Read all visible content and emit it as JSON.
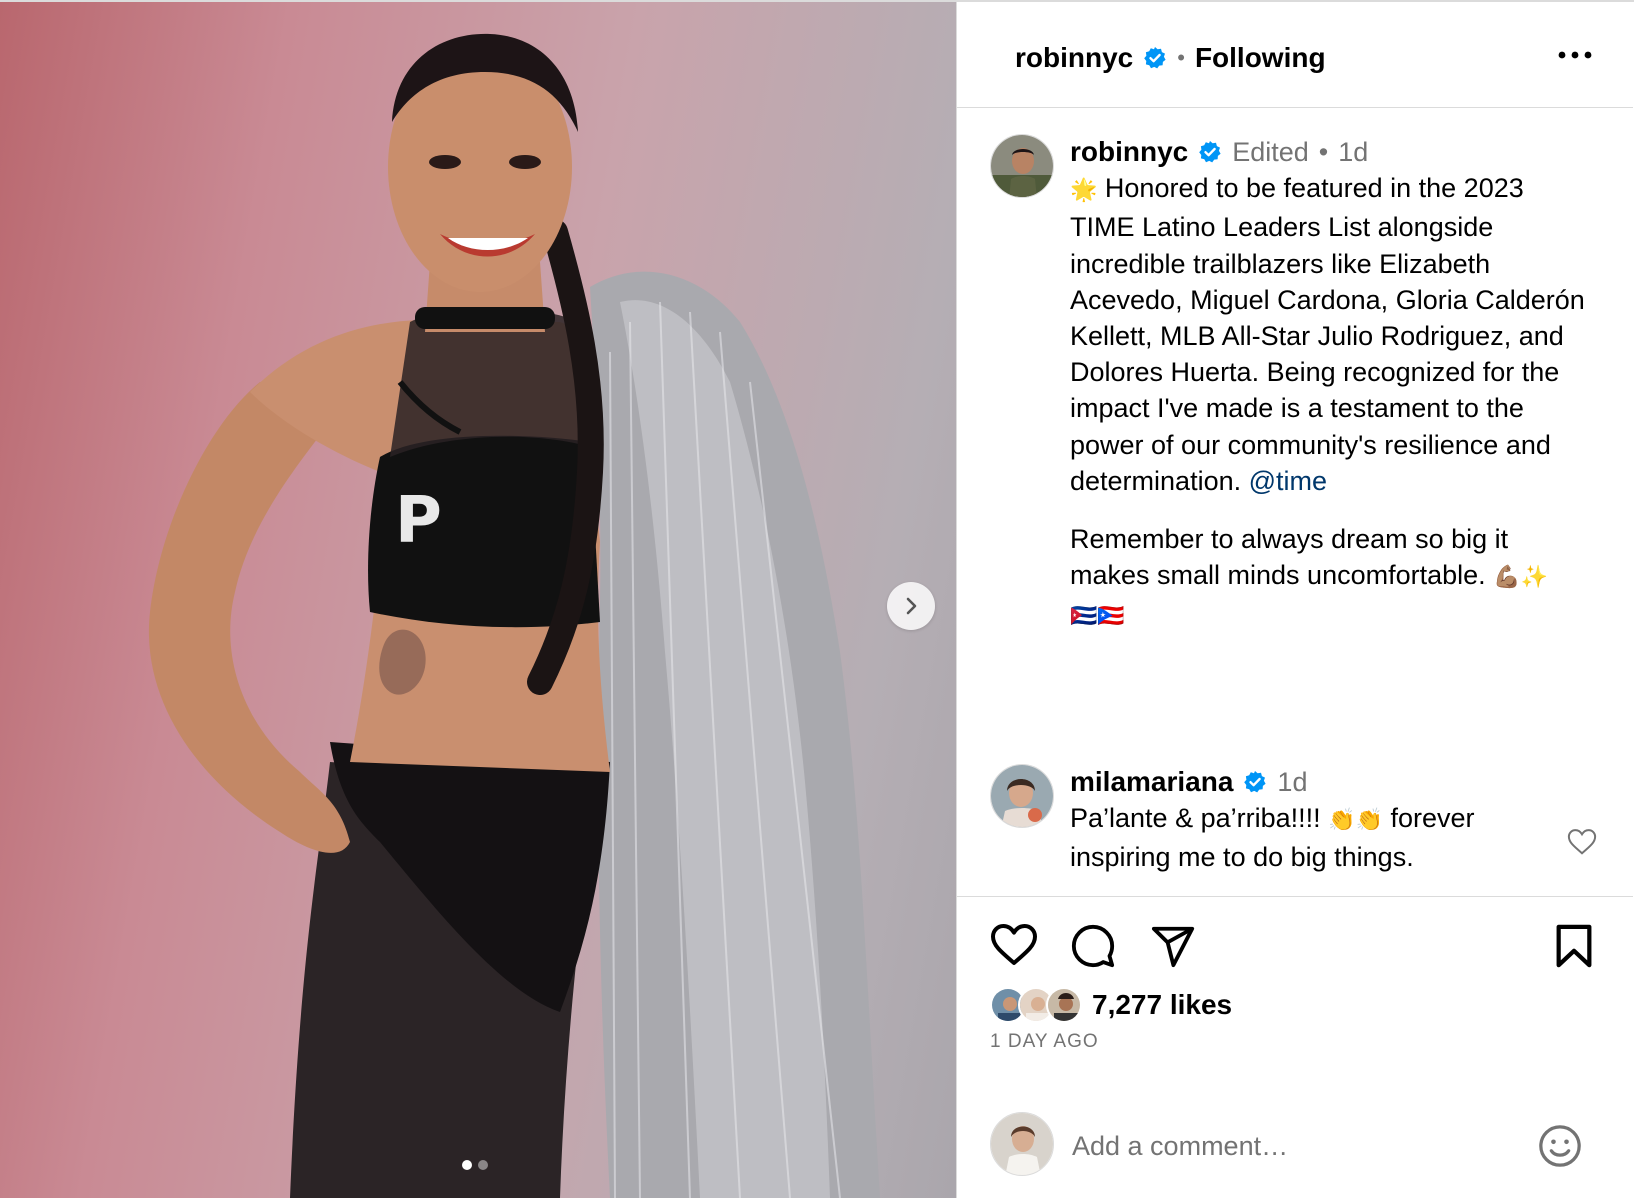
{
  "header": {
    "username": "robinnyc",
    "verified_icon": "verified-badge-icon",
    "separator": "•",
    "follow_status": "Following",
    "more_icon": "more-horizontal-icon"
  },
  "media": {
    "next_icon": "chevron-right-icon",
    "carousel_index": 1,
    "carousel_total": 2
  },
  "caption": {
    "username": "robinnyc",
    "edited_label": "Edited",
    "separator": "•",
    "time": "1d",
    "star_emoji": "🌟",
    "text_main": "Honored to be featured in the 2023 TIME Latino Leaders List alongside incredible trailblazers like Elizabeth Acevedo, Miguel Cardona, Gloria Calderón Kellett, MLB All-Star Julio Rodriguez, and Dolores Huerta. Being recognized for the impact I've made is a testament to the power of our community's resilience and determination.",
    "mention": "@time",
    "text_second": "Remember to always dream so big it makes small minds uncomfortable.",
    "trailing_emojis": "💪🏽✨",
    "flag_emojis": "🇨🇺🇵🇷"
  },
  "comment": {
    "username": "milamariana",
    "time": "1d",
    "text_start": "Pa’lante & pa’rriba!!!!",
    "emojis": "👏👏",
    "text_end": "forever inspiring me to do big things."
  },
  "actions": {
    "like_icon": "heart-icon",
    "comment_icon": "comment-icon",
    "share_icon": "send-icon",
    "save_icon": "bookmark-icon"
  },
  "likes": {
    "count_label": "7,277 likes"
  },
  "timestamp": "1 DAY AGO",
  "add_comment": {
    "placeholder": "Add a comment…",
    "emoji_icon": "smiley-icon"
  },
  "colors": {
    "verified": "#0095f6",
    "mention": "#00376b",
    "secondary_text": "#737373",
    "border": "#dbdbdb"
  }
}
